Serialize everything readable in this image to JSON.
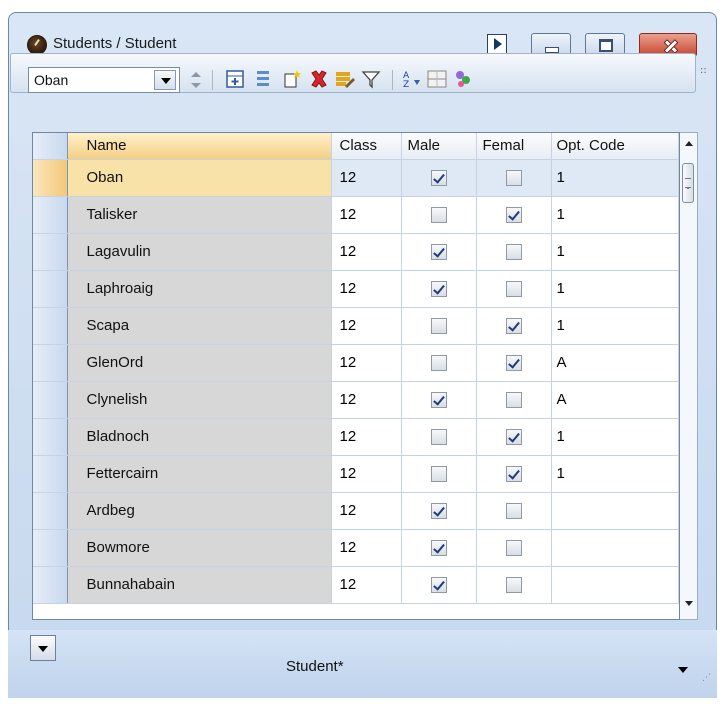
{
  "window": {
    "title": "Students / Student"
  },
  "toolbar": {
    "navigator_value": "Oban",
    "icons": [
      "navigator-dropdown-icon",
      "spinner-icon",
      "add-record-icon",
      "list-icon",
      "new-icon",
      "delete-icon",
      "edit-icon",
      "filter-icon",
      "sort-icon",
      "table-layout-icon",
      "users-icon"
    ]
  },
  "grid": {
    "columns": [
      "Name",
      "Class",
      "Male",
      "Femal",
      "Opt. Code"
    ],
    "rows": [
      {
        "name": "Oban",
        "class": "12",
        "male": true,
        "female": false,
        "opt": "1"
      },
      {
        "name": "Talisker",
        "class": "12",
        "male": false,
        "female": true,
        "opt": "1"
      },
      {
        "name": "Lagavulin",
        "class": "12",
        "male": true,
        "female": false,
        "opt": "1"
      },
      {
        "name": "Laphroaig",
        "class": "12",
        "male": true,
        "female": false,
        "opt": "1"
      },
      {
        "name": "Scapa",
        "class": "12",
        "male": false,
        "female": true,
        "opt": "1"
      },
      {
        "name": "GlenOrd",
        "class": "12",
        "male": false,
        "female": true,
        "opt": "A"
      },
      {
        "name": "Clynelish",
        "class": "12",
        "male": true,
        "female": false,
        "opt": "A"
      },
      {
        "name": "Bladnoch",
        "class": "12",
        "male": false,
        "female": true,
        "opt": "1"
      },
      {
        "name": "Fettercairn",
        "class": "12",
        "male": false,
        "female": true,
        "opt": "1"
      },
      {
        "name": "Ardbeg",
        "class": "12",
        "male": true,
        "female": false,
        "opt": ""
      },
      {
        "name": "Bowmore",
        "class": "12",
        "male": true,
        "female": false,
        "opt": ""
      },
      {
        "name": "Bunnahabain",
        "class": "12",
        "male": true,
        "female": false,
        "opt": ""
      }
    ]
  },
  "footer": {
    "form_selector": "Student*"
  },
  "colors": {
    "title_bar": "#c6d8ee",
    "selected_row": "#f8e2a7",
    "close_button": "#c9452d"
  }
}
